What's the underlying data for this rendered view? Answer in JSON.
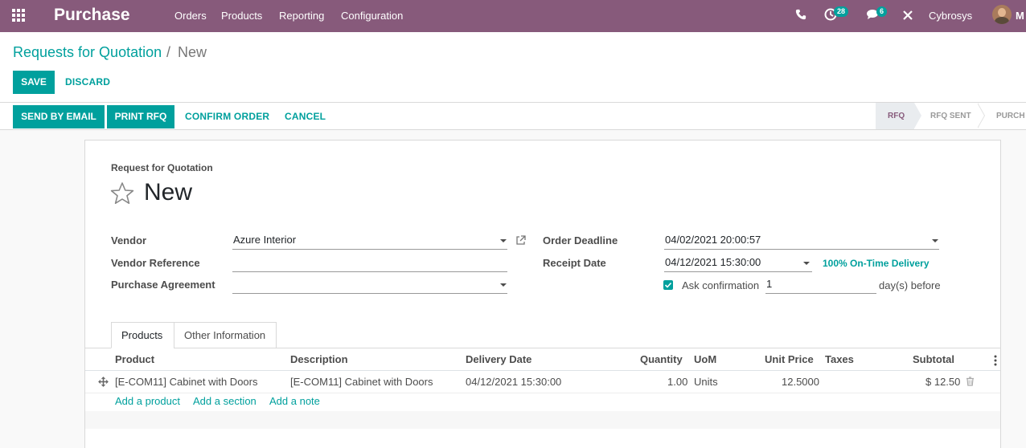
{
  "navbar": {
    "app_name": "Purchase",
    "menus": [
      "Orders",
      "Products",
      "Reporting",
      "Configuration"
    ],
    "activity_count": "28",
    "message_count": "6",
    "company": "Cybrosys",
    "user_initial": "M"
  },
  "breadcrumb": {
    "parent": "Requests for Quotation",
    "separator": "/",
    "current": "New"
  },
  "actions": {
    "save": "SAVE",
    "discard": "DISCARD"
  },
  "header_buttons": {
    "send_email": "SEND BY EMAIL",
    "print_rfq": "PRINT RFQ",
    "confirm": "CONFIRM ORDER",
    "cancel": "CANCEL"
  },
  "statusbar": {
    "stages": [
      "RFQ",
      "RFQ SENT",
      "PURCH"
    ],
    "active": "RFQ"
  },
  "form": {
    "doc_type": "Request for Quotation",
    "name": "New",
    "vendor_label": "Vendor",
    "vendor_value": "Azure Interior",
    "vendor_ref_label": "Vendor Reference",
    "vendor_ref_value": "",
    "agreement_label": "Purchase Agreement",
    "agreement_value": "",
    "deadline_label": "Order Deadline",
    "deadline_value": "04/02/2021 20:00:57",
    "receipt_label": "Receipt Date",
    "receipt_value": "04/12/2021 15:30:00",
    "ontime_link": "100% On-Time Delivery",
    "ask_label": "Ask confirmation",
    "ask_checked": true,
    "ask_days": "1",
    "days_suffix": "day(s) before"
  },
  "tabs": [
    {
      "label": "Products",
      "active": true
    },
    {
      "label": "Other Information",
      "active": false
    }
  ],
  "table": {
    "headers": [
      "Product",
      "Description",
      "Delivery Date",
      "Quantity",
      "UoM",
      "Unit Price",
      "Taxes",
      "Subtotal"
    ],
    "rows": [
      {
        "product": "[E-COM11] Cabinet with Doors",
        "description": "[E-COM11] Cabinet with Doors",
        "delivery": "04/12/2021 15:30:00",
        "quantity": "1.00",
        "uom": "Units",
        "unit_price": "12.5000",
        "taxes": "",
        "subtotal": "$ 12.50"
      }
    ],
    "add_links": [
      "Add a product",
      "Add a section",
      "Add a note"
    ]
  },
  "colors": {
    "brand": "#875a7b",
    "accent": "#00a09d"
  }
}
